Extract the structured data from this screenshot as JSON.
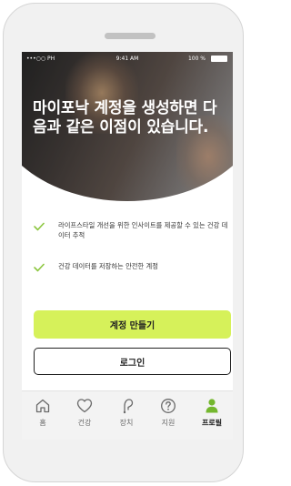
{
  "status_bar": {
    "carrier": "•••○○ PH",
    "time": "9:41 AM",
    "battery": "100 %"
  },
  "headline": "마이포낙 계정을 생성하면 다음과 같은 이점이 있습니다.",
  "benefits": [
    {
      "icon": "check-icon",
      "text": "라이프스타일 개선을 위한 인사이트를 제공할 수 있는 건강 데이터 추적"
    },
    {
      "icon": "check-icon",
      "text": "건강 데이터를 저장하는 안전한 계정"
    }
  ],
  "buttons": {
    "create_account": "계정 만들기",
    "login": "로그인"
  },
  "tabs": [
    {
      "label": "홈",
      "icon": "home-icon"
    },
    {
      "label": "건강",
      "icon": "heart-icon"
    },
    {
      "label": "장치",
      "icon": "hearing-aid-icon"
    },
    {
      "label": "지원",
      "icon": "help-icon"
    },
    {
      "label": "프로필",
      "icon": "profile-icon",
      "active": true
    }
  ],
  "colors": {
    "accent": "#d6f15a",
    "check": "#8cc63f",
    "active_tab": "#74b72e"
  }
}
